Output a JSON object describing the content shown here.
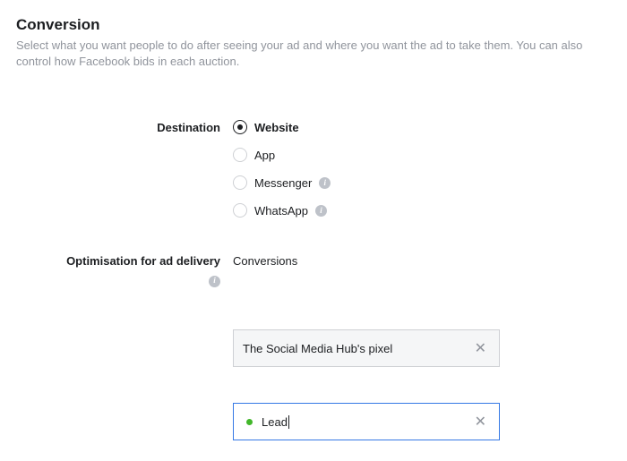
{
  "section": {
    "title": "Conversion",
    "description": "Select what you want people to do after seeing your ad and where you want the ad to take them. You can also control how Facebook bids in each auction."
  },
  "destination": {
    "label": "Destination",
    "options": [
      {
        "label": "Website",
        "selected": true,
        "info": false
      },
      {
        "label": "App",
        "selected": false,
        "info": false
      },
      {
        "label": "Messenger",
        "selected": false,
        "info": true
      },
      {
        "label": "WhatsApp",
        "selected": false,
        "info": true
      }
    ]
  },
  "optimisation": {
    "label": "Optimisation for ad delivery",
    "value": "Conversions"
  },
  "pixel": {
    "value": "The Social Media Hub's pixel"
  },
  "event_input": {
    "value": "Lead",
    "status_color": "#42b72a"
  }
}
